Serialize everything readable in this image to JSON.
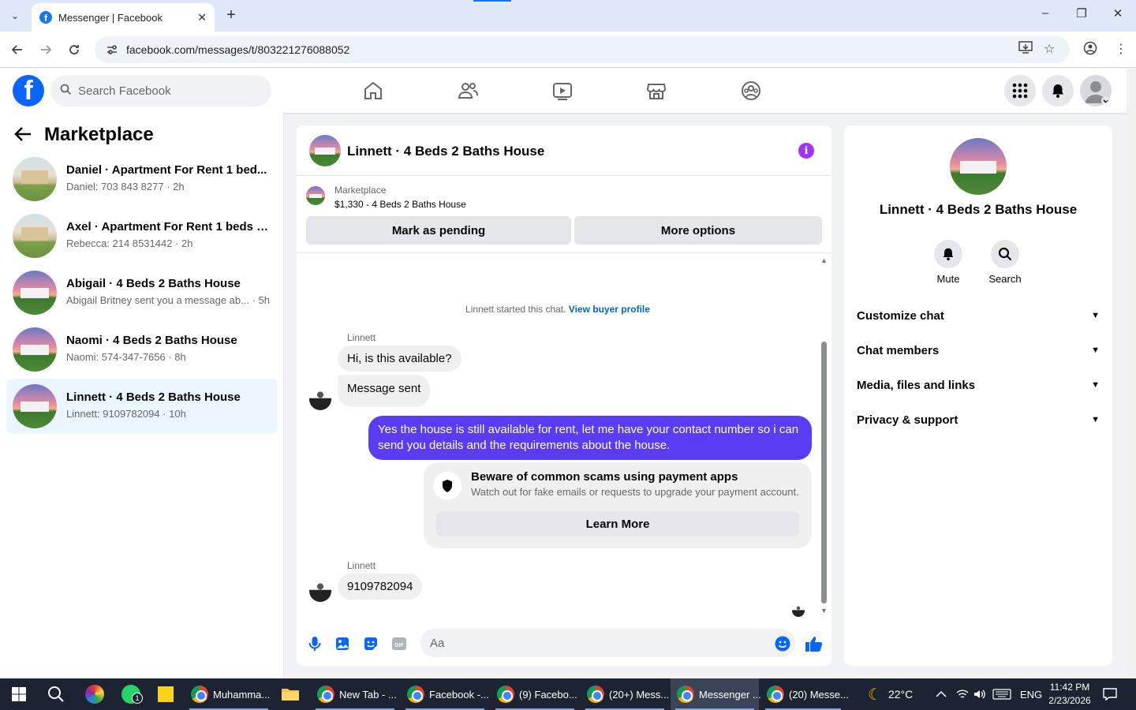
{
  "browser": {
    "tab_title": "Messenger | Facebook",
    "url": "facebook.com/messages/t/803221276088052"
  },
  "fb": {
    "search_placeholder": "Search Facebook"
  },
  "sidebar": {
    "title": "Marketplace",
    "conversations": [
      {
        "name": "Daniel · Apartment For Rent 1 bed...",
        "preview": "Daniel: 703 843 8277 · 2h"
      },
      {
        "name": "Axel · Apartment For Rent 1 beds 1...",
        "preview": "Rebecca: 214 8531442 · 2h"
      },
      {
        "name": "Abigail · 4 Beds 2 Baths House",
        "preview": "Abigail Britney sent you a message ab... · 5h"
      },
      {
        "name": "Naomi · 4 Beds 2 Baths House",
        "preview": "Naomi: 574-347-7656 · 8h"
      },
      {
        "name": "Linnett · 4 Beds 2 Baths House",
        "preview": "Linnett: 9109782094 · 10h"
      }
    ]
  },
  "chat": {
    "title": "Linnett · 4 Beds 2 Baths House",
    "marketplace_label": "Marketplace",
    "listing": "$1,330 - 4 Beds 2 Baths House",
    "mark_pending": "Mark as pending",
    "more_options": "More options",
    "started_text": "Linnett started this chat.",
    "view_buyer_profile": "View buyer profile",
    "sender_name": "Linnett",
    "msg1": "Hi, is this available?",
    "msg2": "Message sent",
    "reply_line1": "Yes the house is still available for rent, let me have your contact number so i can",
    "reply_line2": "send you details and the requirements about the house.",
    "scam_title": "Beware of common scams using payment apps",
    "scam_desc": "Watch out for fake emails or requests to upgrade your payment account.",
    "learn_more": "Learn More",
    "sender_name2": "Linnett",
    "msg3": "9109782094",
    "composer_placeholder": "Aa"
  },
  "details": {
    "name": "Linnett · 4 Beds 2 Baths House",
    "mute": "Mute",
    "search": "Search",
    "sections": [
      "Customize chat",
      "Chat members",
      "Media, files and links",
      "Privacy & support"
    ]
  },
  "taskbar": {
    "items": [
      "Muhamma...",
      "New Tab - ...",
      "Facebook -...",
      "(9) Facebo...",
      "(20+) Mess...",
      "Messenger ...",
      "(20) Messe..."
    ],
    "temperature": "22°C",
    "lang": "ENG",
    "time": "11:42 PM",
    "date": "2/23/2026",
    "badge_whatsapp": "1"
  },
  "colors": {
    "fb_blue": "#0866ff",
    "outgoing_bubble": "#5b3cf5",
    "active_conv": "#ebf5ff"
  }
}
